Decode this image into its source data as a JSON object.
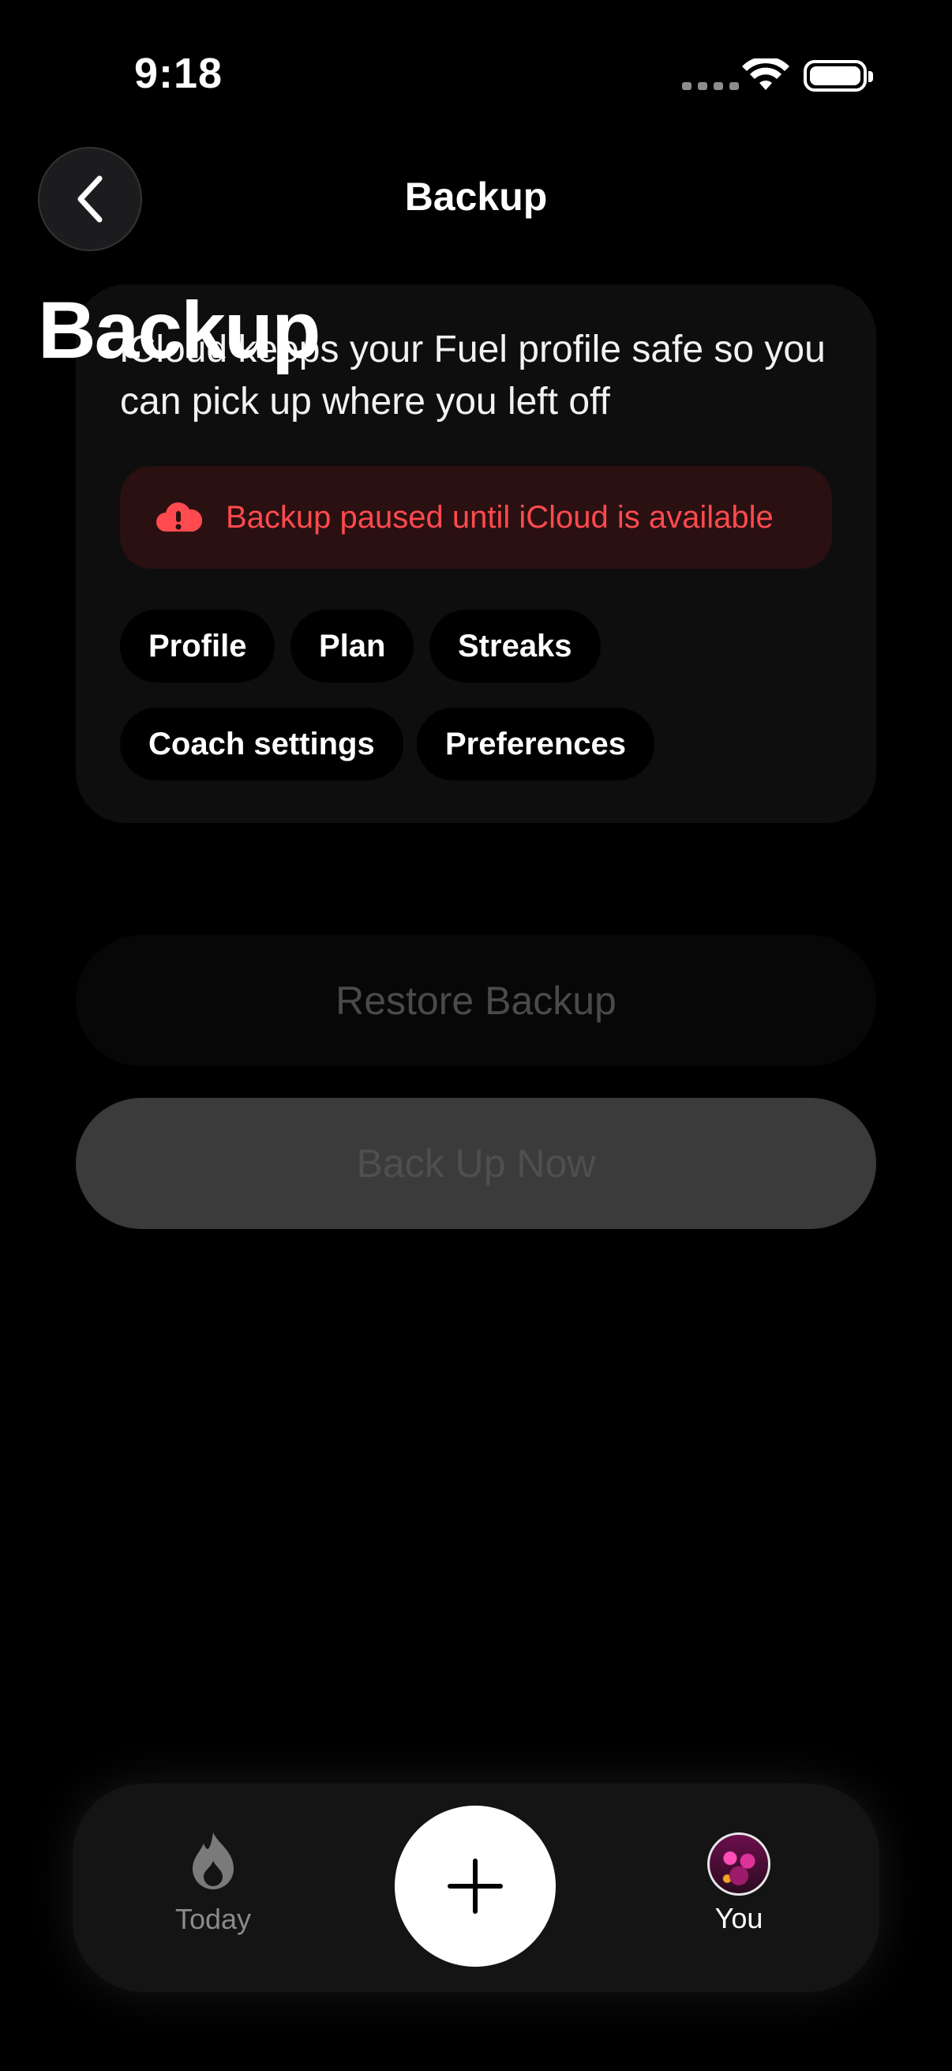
{
  "status_bar": {
    "time": "9:18"
  },
  "nav": {
    "title": "Backup"
  },
  "header": {
    "large_title": "Backup"
  },
  "card": {
    "description": "iCloud keeps your Fuel profile safe so you can pick up where you left off",
    "alert": {
      "text": "Backup paused until iCloud is available",
      "color": "#ff4a4f"
    },
    "chips": [
      "Profile",
      "Plan",
      "Streaks",
      "Coach settings",
      "Preferences"
    ]
  },
  "actions": {
    "restore_label": "Restore Backup",
    "backup_now_label": "Back Up Now"
  },
  "tabbar": {
    "today_label": "Today",
    "you_label": "You",
    "add_icon": "plus-icon"
  }
}
